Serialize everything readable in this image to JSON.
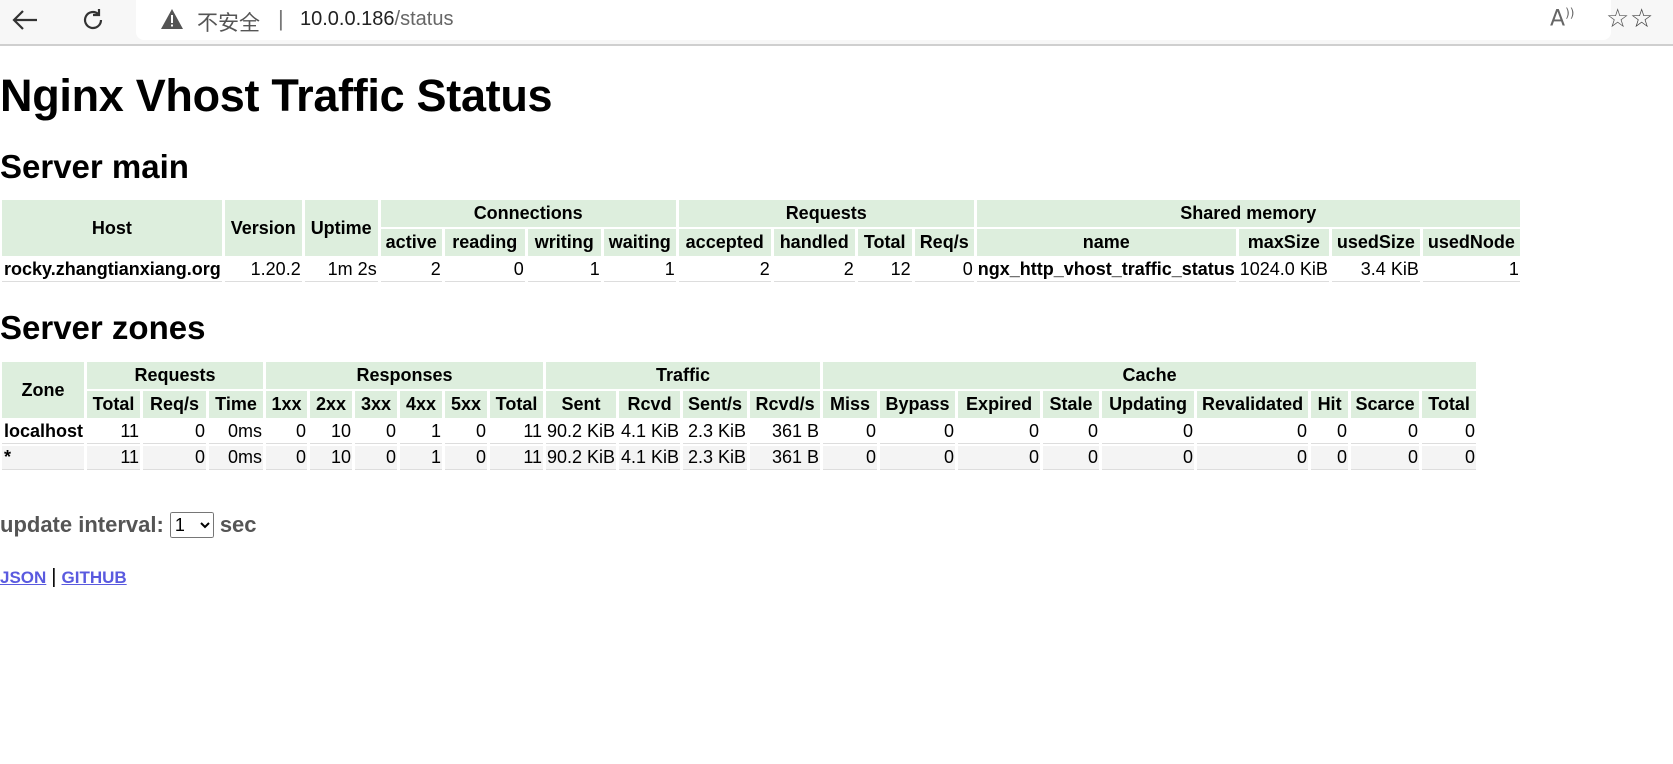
{
  "browser": {
    "security_label": "不安全",
    "url_host": "10.0.0.186",
    "url_path": "/status"
  },
  "page": {
    "title": "Nginx Vhost Traffic Status",
    "server_main_heading": "Server main",
    "server_zones_heading": "Server zones"
  },
  "server_main": {
    "headers": {
      "host": "Host",
      "version": "Version",
      "uptime": "Uptime",
      "connections": "Connections",
      "requests": "Requests",
      "shared_memory": "Shared memory",
      "active": "active",
      "reading": "reading",
      "writing": "writing",
      "waiting": "waiting",
      "accepted": "accepted",
      "handled": "handled",
      "total": "Total",
      "req_s": "Req/s",
      "name": "name",
      "max_size": "maxSize",
      "used_size": "usedSize",
      "used_node": "usedNode"
    },
    "row": {
      "host": "rocky.zhangtianxiang.org",
      "version": "1.20.2",
      "uptime": "1m 2s",
      "active": "2",
      "reading": "0",
      "writing": "1",
      "waiting": "1",
      "accepted": "2",
      "handled": "2",
      "total": "12",
      "req_s": "0",
      "name": "ngx_http_vhost_traffic_status",
      "max_size": "1024.0 KiB",
      "used_size": "3.4 KiB",
      "used_node": "1"
    }
  },
  "server_zones": {
    "headers": {
      "zone": "Zone",
      "requests": "Requests",
      "responses": "Responses",
      "traffic": "Traffic",
      "cache": "Cache",
      "total": "Total",
      "req_s": "Req/s",
      "time": "Time",
      "r1xx": "1xx",
      "r2xx": "2xx",
      "r3xx": "3xx",
      "r4xx": "4xx",
      "r5xx": "5xx",
      "sent": "Sent",
      "rcvd": "Rcvd",
      "sent_s": "Sent/s",
      "rcvd_s": "Rcvd/s",
      "miss": "Miss",
      "bypass": "Bypass",
      "expired": "Expired",
      "stale": "Stale",
      "updating": "Updating",
      "revalidated": "Revalidated",
      "hit": "Hit",
      "scarce": "Scarce"
    },
    "rows": [
      {
        "zone": "localhost",
        "total": "11",
        "req_s": "0",
        "time": "0ms",
        "r1xx": "0",
        "r2xx": "10",
        "r3xx": "0",
        "r4xx": "1",
        "r5xx": "0",
        "resp_total": "11",
        "sent": "90.2 KiB",
        "rcvd": "4.1 KiB",
        "sent_s": "2.3 KiB",
        "rcvd_s": "361 B",
        "miss": "0",
        "bypass": "0",
        "expired": "0",
        "stale": "0",
        "updating": "0",
        "revalidated": "0",
        "hit": "0",
        "scarce": "0",
        "cache_total": "0"
      },
      {
        "zone": "*",
        "total": "11",
        "req_s": "0",
        "time": "0ms",
        "r1xx": "0",
        "r2xx": "10",
        "r3xx": "0",
        "r4xx": "1",
        "r5xx": "0",
        "resp_total": "11",
        "sent": "90.2 KiB",
        "rcvd": "4.1 KiB",
        "sent_s": "2.3 KiB",
        "rcvd_s": "361 B",
        "miss": "0",
        "bypass": "0",
        "expired": "0",
        "stale": "0",
        "updating": "0",
        "revalidated": "0",
        "hit": "0",
        "scarce": "0",
        "cache_total": "0"
      }
    ]
  },
  "footer": {
    "interval_label": "update interval:",
    "interval_value": "1",
    "interval_unit": "sec",
    "json_link": "JSON",
    "github_link": "GITHUB"
  }
}
